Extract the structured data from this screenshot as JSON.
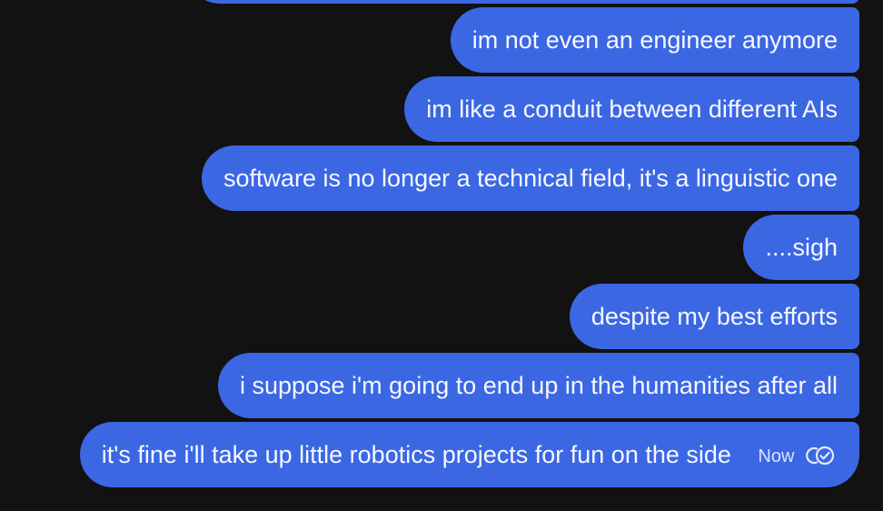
{
  "messages": [
    {
      "text": "im not even an engineer anymore"
    },
    {
      "text": "im like a conduit between different AIs"
    },
    {
      "text": "software is no longer a technical field, it's a linguistic one"
    },
    {
      "text": "....sigh"
    },
    {
      "text": "despite my best efforts"
    },
    {
      "text": "i suppose i'm going to end up in the humanities after all"
    },
    {
      "text": "it's fine i'll take up little robotics projects for fun on the side",
      "timestamp": "Now",
      "status_icon": "double-check-icon"
    }
  ],
  "colors": {
    "background": "#121212",
    "bubble": "#3b67e3",
    "text": "#f6f8ff"
  }
}
